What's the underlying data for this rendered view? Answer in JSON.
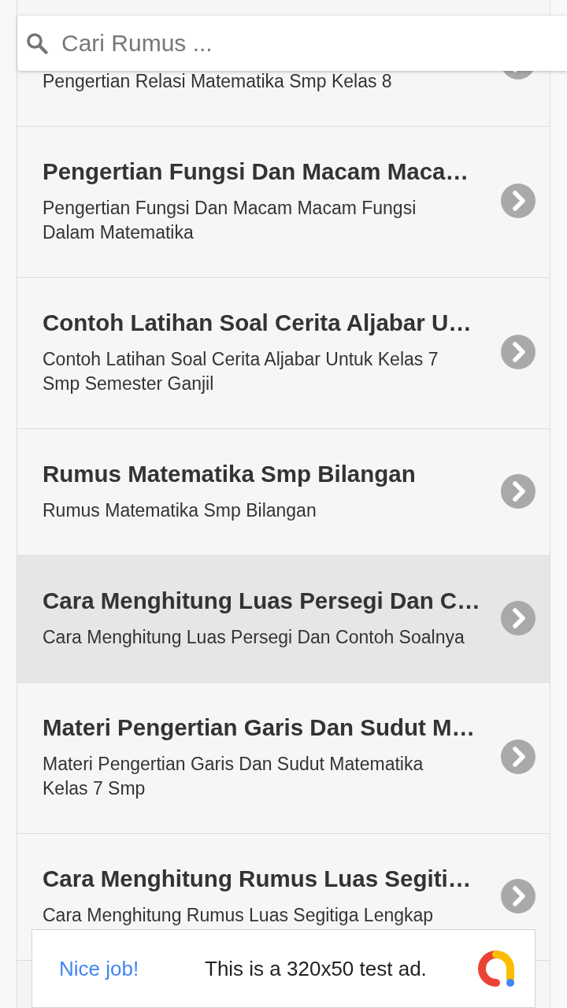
{
  "search": {
    "placeholder": "Cari Rumus ..."
  },
  "items": [
    {
      "description": "Pengertian Relasi Matematika Smp Kelas 8",
      "selected": false
    },
    {
      "title": "Pengertian Fungsi Dan Macam Maca…",
      "description": "Pengertian Fungsi Dan Macam Macam Fungsi Dalam Matematika",
      "selected": false
    },
    {
      "title": "Contoh Latihan Soal Cerita Aljabar U…",
      "description": "Contoh Latihan Soal Cerita Aljabar Untuk Kelas 7 Smp Semester Ganjil",
      "selected": false
    },
    {
      "title": "Rumus Matematika Smp Bilangan",
      "description": "Rumus Matematika Smp Bilangan",
      "selected": false
    },
    {
      "title": "Cara Menghitung Luas Persegi Dan C…",
      "description": "Cara Menghitung Luas Persegi Dan Contoh Soalnya",
      "selected": true
    },
    {
      "title": "Materi Pengertian Garis Dan Sudut M…",
      "description": "Materi Pengertian Garis Dan Sudut Matematika Kelas 7 Smp",
      "selected": false
    },
    {
      "title": "Cara Menghitung Rumus Luas Segiti…",
      "description": "Cara Menghitung Rumus Luas Segitiga Lengkap",
      "selected": false
    }
  ],
  "ad": {
    "headline": "Nice job!",
    "text": "This is a 320x50 test ad."
  }
}
